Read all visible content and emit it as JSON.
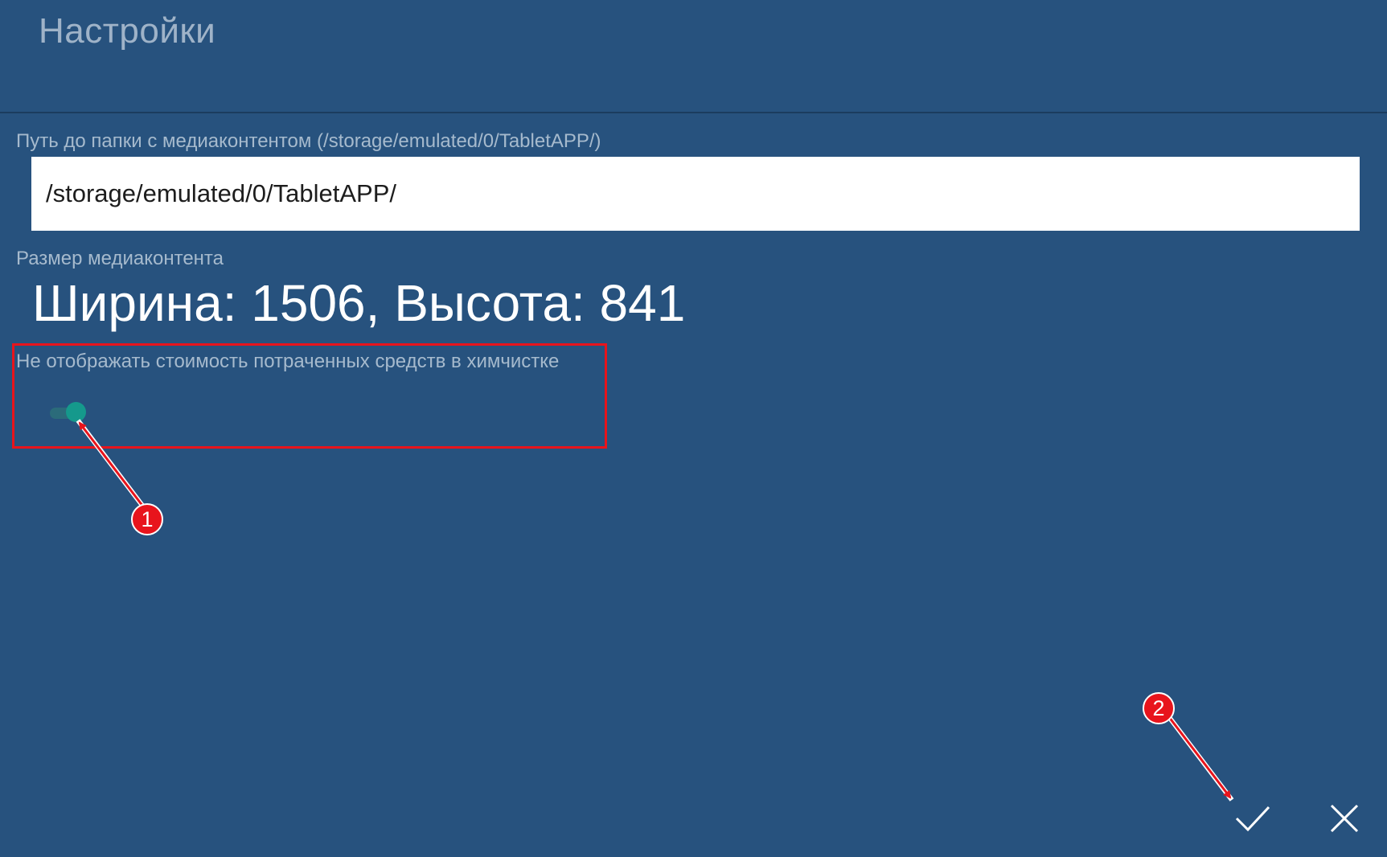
{
  "header": {
    "title": "Настройки"
  },
  "settings": {
    "media_path": {
      "label": "Путь до папки с медиаконтентом (/storage/emulated/0/TabletAPP/)",
      "value": "/storage/emulated/0/TabletAPP/"
    },
    "media_size": {
      "label": "Размер медиаконтента",
      "value": "Ширина: 1506, Высота: 841"
    },
    "hide_cost": {
      "label": "Не отображать стоимость потраченных средств в химчистке",
      "enabled": true
    }
  },
  "actions": {
    "confirm_icon": "check-icon",
    "cancel_icon": "close-icon"
  },
  "annotations": {
    "badge_1": "1",
    "badge_2": "2",
    "color": "#e8141c"
  },
  "colors": {
    "background": "#27527e",
    "toggle_on": "#15998c",
    "label": "#a6bacd"
  }
}
